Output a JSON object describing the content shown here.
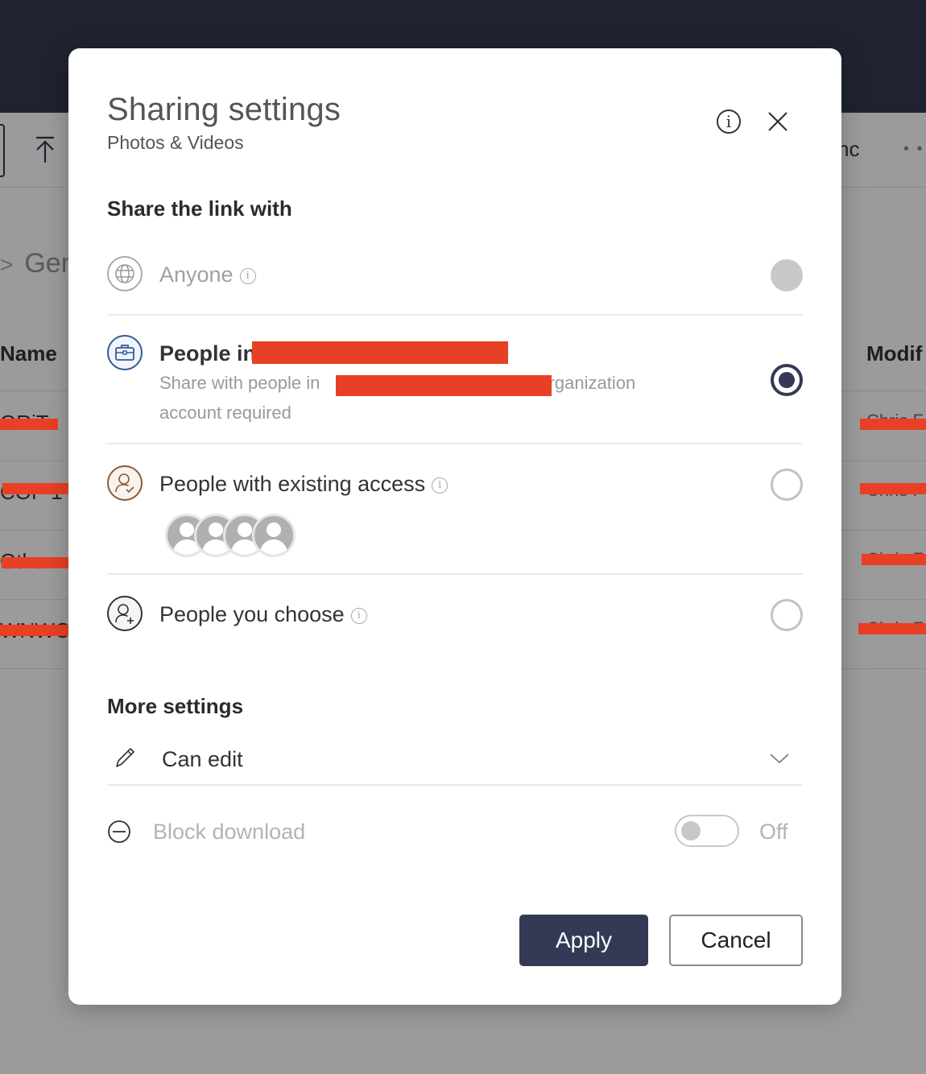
{
  "background": {
    "sync_text_fragment": "nc",
    "more_icon": "more-horizontal-icon",
    "breadcrumb_fragment": "Ger",
    "columns": {
      "name": "Name",
      "modified": "Modif"
    },
    "rows": [
      {
        "name": "ORiT",
        "modified": "Chris F"
      },
      {
        "name": "COP 1",
        "modified": "Chris F"
      },
      {
        "name": "Other",
        "modified": "Chris F"
      },
      {
        "name": "WNWC",
        "modified": "Chris F"
      }
    ],
    "redaction_color": "#e84025"
  },
  "dialog": {
    "title": "Sharing settings",
    "subtitle": "Photos & Videos",
    "info_icon": "info-icon",
    "close_icon": "close-icon",
    "share_heading": "Share the link with",
    "options": [
      {
        "id": "anyone",
        "label": "Anyone",
        "icon": "globe-icon",
        "has_info": true,
        "state": "disabled"
      },
      {
        "id": "org",
        "label": "People in",
        "label_redacted": true,
        "description_prefix": "Share with people in",
        "description_suffix": "organization",
        "description_line2": "account required",
        "icon": "briefcase-icon",
        "state": "selected"
      },
      {
        "id": "existing",
        "label": "People with existing access",
        "icon": "person-check-icon",
        "has_info": true,
        "avatar_count": 4,
        "state": "unselected"
      },
      {
        "id": "choose",
        "label": "People you choose",
        "icon": "person-add-icon",
        "has_info": true,
        "state": "unselected"
      }
    ],
    "more_heading": "More settings",
    "permission": {
      "label": "Can edit",
      "icon": "pencil-icon"
    },
    "block_download": {
      "label": "Block download",
      "icon": "block-icon",
      "state_label": "Off",
      "enabled": false
    },
    "apply_label": "Apply",
    "cancel_label": "Cancel",
    "accent_color": "#343a55"
  }
}
